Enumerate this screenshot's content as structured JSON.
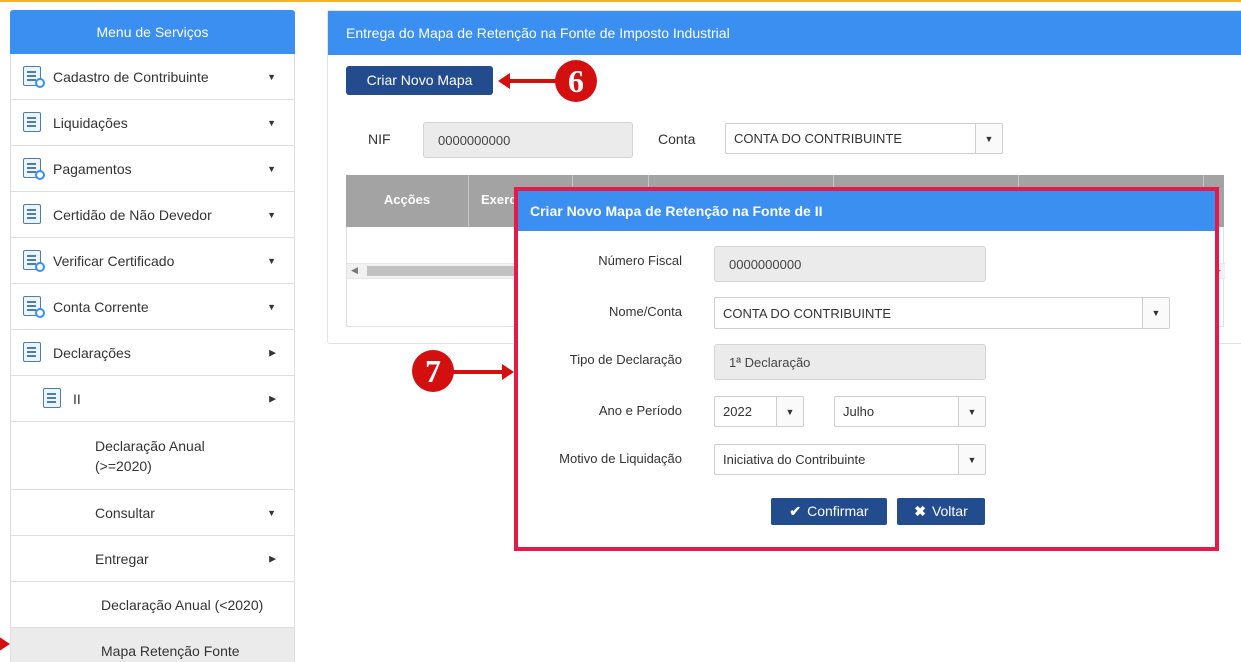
{
  "sidebar": {
    "title": "Menu de Serviços",
    "items": [
      {
        "label": "Cadastro de Contribuinte",
        "icon": "form-search-icon",
        "caret": "▼"
      },
      {
        "label": "Liquidações",
        "icon": "edit-document-icon",
        "caret": "▼"
      },
      {
        "label": "Pagamentos",
        "icon": "payment-search-icon",
        "caret": "▼"
      },
      {
        "label": "Certidão de Não Devedor",
        "icon": "certificate-icon",
        "caret": "▼"
      },
      {
        "label": "Verificar Certificado",
        "icon": "verify-search-icon",
        "caret": "▼"
      },
      {
        "label": "Conta Corrente",
        "icon": "account-search-icon",
        "caret": "▼"
      },
      {
        "label": "Declarações",
        "icon": "declaration-icon",
        "caret": "▶"
      },
      {
        "label": "II",
        "icon": "ii-document-icon",
        "caret": "▶"
      },
      {
        "label": "Declaração Anual (>=2020)"
      },
      {
        "label": "Consultar",
        "caret": "▼"
      },
      {
        "label": "Entregar",
        "caret": "▶"
      },
      {
        "label": "Declaração Anual (<2020)"
      },
      {
        "label": "Mapa Retenção Fonte"
      }
    ]
  },
  "main": {
    "title": "Entrega do Mapa de Retenção na Fonte de Imposto Industrial",
    "new_button": "Criar Novo Mapa",
    "nif_label": "NIF",
    "nif_value": "0000000000",
    "conta_label": "Conta",
    "conta_value": "CONTA DO CONTRIBUINTE",
    "table_headers": [
      "Acções",
      "Exerc"
    ]
  },
  "modal": {
    "title": "Criar Novo Mapa de Retenção na Fonte de II",
    "numero_fiscal_label": "Número Fiscal",
    "numero_fiscal_value": "0000000000",
    "nome_conta_label": "Nome/Conta",
    "nome_conta_value": "CONTA DO CONTRIBUINTE",
    "tipo_label": "Tipo de Declaração",
    "tipo_value": "1ª Declaração",
    "ano_label": "Ano e Período",
    "ano_value": "2022",
    "periodo_value": "Julho",
    "motivo_label": "Motivo de Liquidação",
    "motivo_value": "Iniciativa do Contribuinte",
    "confirm_button": "Confirmar",
    "back_button": "Voltar",
    "confirm_icon": "✔",
    "back_icon": "✖"
  },
  "callouts": {
    "step6": "6",
    "step7": "7"
  },
  "colors": {
    "primary": "#3a8ff0",
    "button": "#234c8e",
    "highlight": "#e31b4b",
    "callout": "#d40f0f"
  }
}
